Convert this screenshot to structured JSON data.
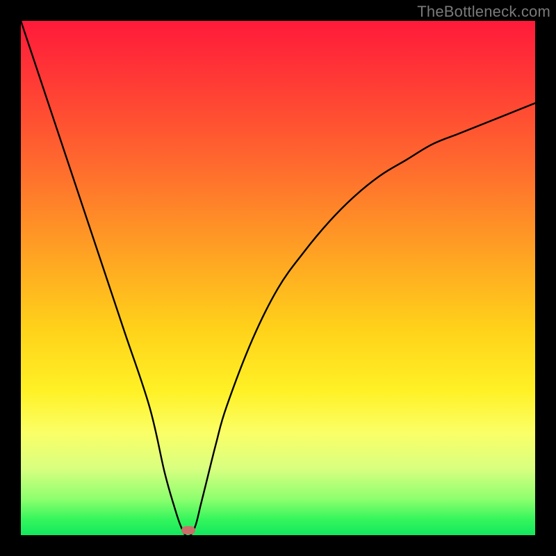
{
  "watermark": {
    "text": "TheBottleneck.com"
  },
  "chart_data": {
    "type": "line",
    "title": "",
    "xlabel": "",
    "ylabel": "",
    "xlim": [
      0,
      100
    ],
    "ylim": [
      0,
      100
    ],
    "legend": false,
    "grid": false,
    "background": "red-yellow-green vertical gradient",
    "series": [
      {
        "name": "bottleneck-curve",
        "x": [
          0,
          5,
          10,
          15,
          20,
          25,
          28,
          30,
          31,
          32,
          33,
          34,
          35,
          36,
          38,
          40,
          45,
          50,
          55,
          60,
          65,
          70,
          75,
          80,
          85,
          90,
          95,
          100
        ],
        "values": [
          100,
          85,
          70,
          55,
          40,
          25,
          12,
          5,
          2,
          0,
          0,
          2,
          6,
          10,
          18,
          25,
          38,
          48,
          55,
          61,
          66,
          70,
          73,
          76,
          78,
          80,
          82,
          84
        ]
      }
    ],
    "marker": {
      "x": 32.5,
      "y": 1.0,
      "color": "#c96f6a"
    }
  }
}
